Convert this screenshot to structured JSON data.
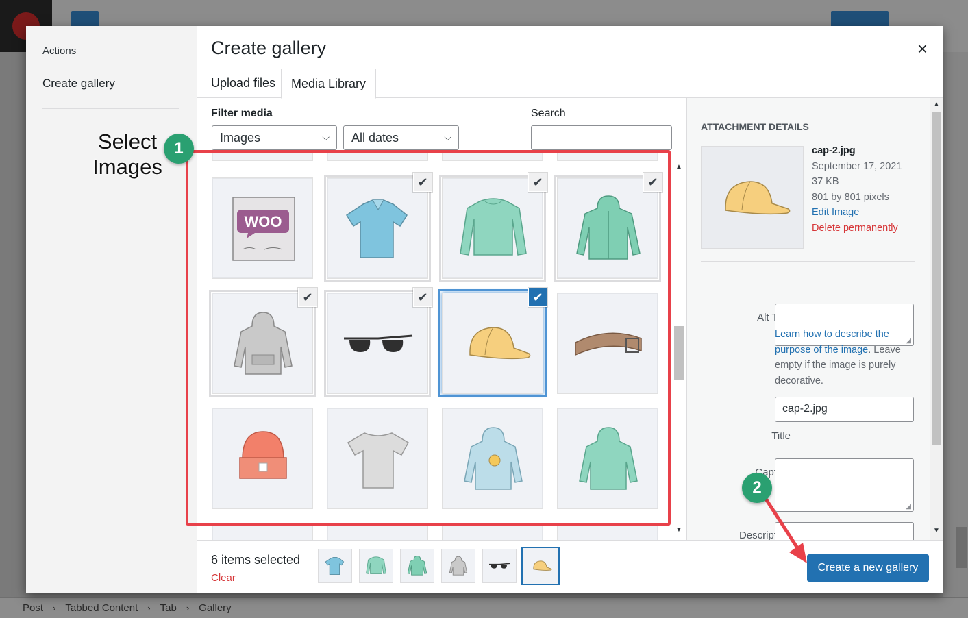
{
  "background": {
    "breadcrumb": [
      "Post",
      "Tabbed Content",
      "Tab",
      "Gallery"
    ]
  },
  "modal": {
    "menu": {
      "heading": "Actions",
      "item": "Create gallery"
    },
    "title": "Create gallery",
    "close_glyph": "×",
    "tabs": [
      {
        "label": "Upload files",
        "active": false
      },
      {
        "label": "Media Library",
        "active": true
      }
    ],
    "filter": {
      "label": "Filter media",
      "type_value": "Images",
      "date_value": "All dates",
      "search_label": "Search"
    },
    "grid": {
      "items": [
        {
          "icon": "woo-album-icon",
          "selected": false
        },
        {
          "icon": "polo-shirt-icon",
          "selected": true
        },
        {
          "icon": "long-sleeve-icon",
          "selected": true
        },
        {
          "icon": "zip-hoodie-icon",
          "selected": true
        },
        {
          "icon": "grey-hoodie-icon",
          "selected": true
        },
        {
          "icon": "sunglasses-icon",
          "selected": true
        },
        {
          "icon": "cap-icon",
          "selected": true,
          "current": true
        },
        {
          "icon": "belt-icon",
          "selected": false
        },
        {
          "icon": "beanie-icon",
          "selected": false
        },
        {
          "icon": "tshirt-icon",
          "selected": false
        },
        {
          "icon": "hoodie-logo-icon",
          "selected": false
        },
        {
          "icon": "green-hoodie-icon",
          "selected": false
        }
      ]
    },
    "attachment": {
      "heading": "ATTACHMENT DETAILS",
      "filename": "cap-2.jpg",
      "date": "September 17, 2021",
      "size": "37 KB",
      "dimensions": "801 by 801 pixels",
      "edit_link": "Edit Image",
      "delete_link": "Delete permanently",
      "alt_label": "Alt Text",
      "alt_help_link": "Learn how to describe the purpose of the image",
      "alt_help_text": ". Leave empty if the image is purely decorative.",
      "title_label": "Title",
      "title_value": "cap-2.jpg",
      "caption_label": "Caption",
      "description_label": "Description"
    },
    "footer": {
      "count": "6 items selected",
      "clear": "Clear",
      "button": "Create a new gallery"
    }
  },
  "annotations": {
    "step1": "1",
    "step2": "2",
    "callout_line1": "Select",
    "callout_line2": "Images",
    "color_red": "#e8414a",
    "color_green": "#2aa071"
  }
}
